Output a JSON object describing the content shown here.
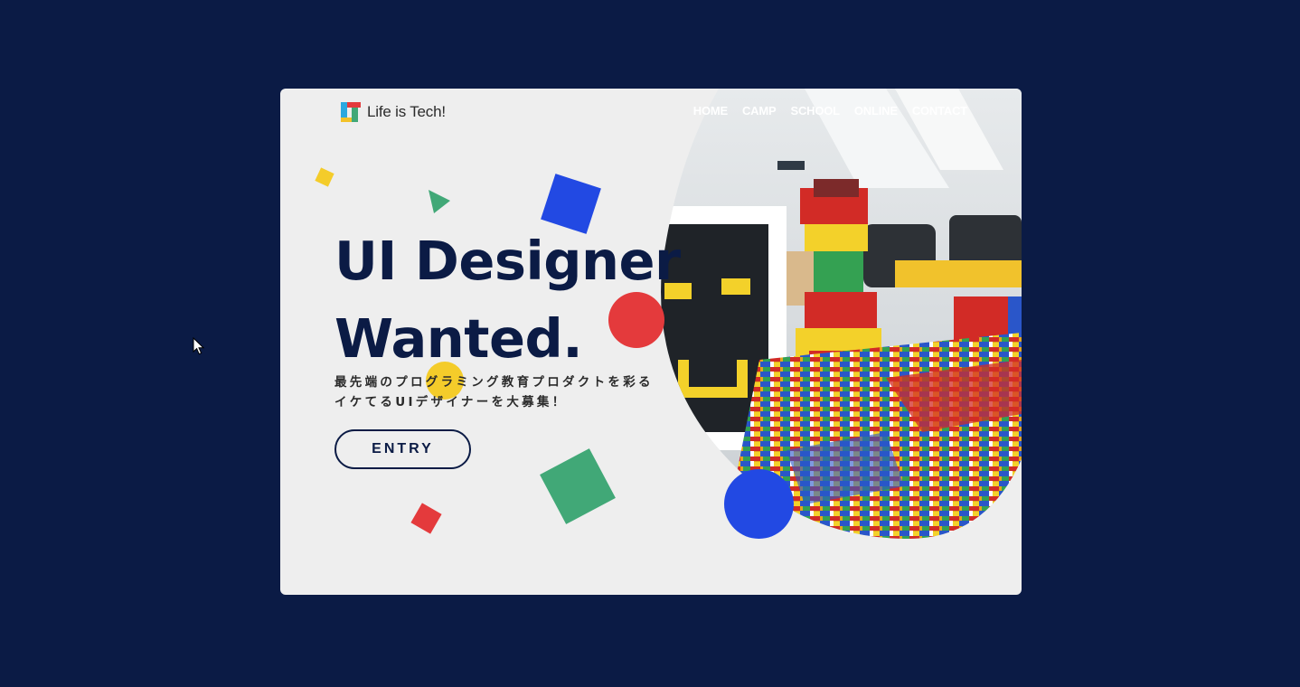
{
  "brand": {
    "name": "Life is Tech!"
  },
  "nav": {
    "items": [
      "HOME",
      "CAMP",
      "SCHOOL",
      "ONLINE",
      "CONTACT"
    ]
  },
  "hero": {
    "title_line1": "UI Designer",
    "title_line2": "Wanted.",
    "subtitle_line1": "最先端のプログラミング教育プロダクトを彩る",
    "subtitle_line2": "イケてるUIデザイナーを大募集！",
    "cta_label": "ENTRY"
  },
  "colors": {
    "page_bg": "#0b1b45",
    "card_bg": "#eeeeee",
    "text_dark": "#0b1b45",
    "yellow": "#f4cc2a",
    "green": "#41a877",
    "blue": "#2249e3",
    "red": "#e43a3c"
  },
  "icons": {
    "cursor": "arrow-cursor-icon",
    "logo": "life-is-tech-logo-icon"
  }
}
